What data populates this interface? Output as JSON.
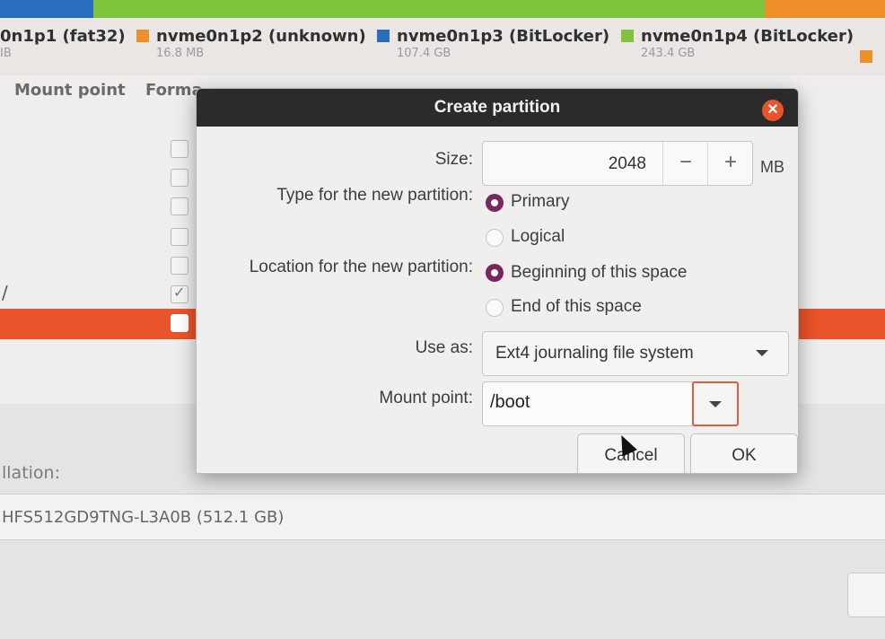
{
  "colors": {
    "accent": "#e9542a",
    "radio_selected": "#7a2760",
    "titlebar": "#2b2b2b",
    "segment_blue": "#2a6fbd",
    "segment_green": "#7fc33d",
    "segment_orange": "#ef8f2a"
  },
  "partition_bar": {
    "segments": [
      {
        "name": "nvme0n1p1",
        "color": "#2a6fbd",
        "fraction": 0.105
      },
      {
        "name": "nvme0n1p4",
        "color": "#7fc33d",
        "fraction": 0.76
      },
      {
        "name": "nvme0n1p2",
        "color": "#ef8f2a",
        "fraction": 0.135
      }
    ]
  },
  "legend": [
    {
      "label": "0n1p1 (fat32)",
      "size": "IB",
      "color": "none"
    },
    {
      "label": "nvme0n1p2 (unknown)",
      "size": "16.8 MB",
      "color": "#ef8f2a"
    },
    {
      "label": "nvme0n1p3 (BitLocker)",
      "size": "107.4 GB",
      "color": "#2a6fbd"
    },
    {
      "label": "nvme0n1p4 (BitLocker)",
      "size": "243.4 GB",
      "color": "#7fc33d"
    }
  ],
  "table": {
    "headers": [
      "Mount point",
      "Forma"
    ],
    "row_mount_slash": "/"
  },
  "bottom": {
    "installation_label": "llation:",
    "device": "HFS512GD9TNG-L3A0B (512.1 GB)"
  },
  "dialog": {
    "title": "Create partition",
    "close_icon": "close-icon",
    "size_label": "Size:",
    "size_value": "2048",
    "size_minus": "−",
    "size_plus": "+",
    "size_unit": "MB",
    "type_label": "Type for the new partition:",
    "type_options": [
      {
        "label": "Primary",
        "selected": true
      },
      {
        "label": "Logical",
        "selected": false
      }
    ],
    "location_label": "Location for the new partition:",
    "location_options": [
      {
        "label": "Beginning of this space",
        "selected": true
      },
      {
        "label": "End of this space",
        "selected": false
      }
    ],
    "use_as_label": "Use as:",
    "use_as_value": "Ext4 journaling file system",
    "mount_label": "Mount point:",
    "mount_value": "/boot",
    "cancel_label": "Cancel",
    "ok_label": "OK"
  }
}
